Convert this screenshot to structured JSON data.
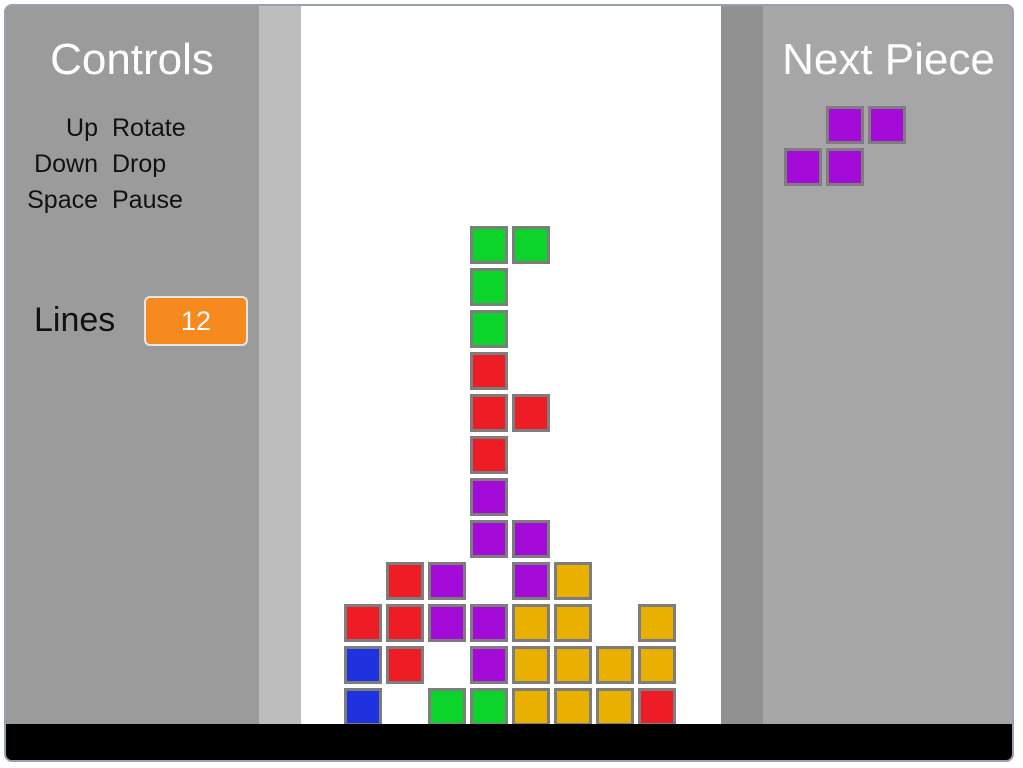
{
  "controls": {
    "title": "Controls",
    "items": [
      {
        "key": "Up",
        "action": "Rotate"
      },
      {
        "key": "Down",
        "action": "Drop"
      },
      {
        "key": "Space",
        "action": "Pause"
      }
    ]
  },
  "lines": {
    "label": "Lines",
    "value": "12"
  },
  "next_piece": {
    "title": "Next Piece",
    "shape": "S",
    "color": "#a40bd9",
    "cells": [
      {
        "col": 1,
        "row": 0
      },
      {
        "col": 2,
        "row": 0
      },
      {
        "col": 0,
        "row": 1
      },
      {
        "col": 1,
        "row": 1
      }
    ]
  },
  "colors": {
    "green": "#0bd42a",
    "red": "#ee1c24",
    "purple": "#a40bd9",
    "blue": "#1f32e0",
    "yellow": "#eab000",
    "lines_badge": "#f68a1e"
  },
  "board": {
    "columns": 10,
    "rows": 17,
    "grid": [
      "..........",
      "..........",
      "..........",
      "..........",
      "..........",
      "...GG.....",
      "...G......",
      "...G......",
      "...R......",
      "...RR.....",
      "...R......",
      "...P......",
      "...PP.....",
      ".RP.PY....",
      "RRPPYY.Y..",
      "BR.PYYYY..",
      "B.GGYYYR.."
    ]
  }
}
